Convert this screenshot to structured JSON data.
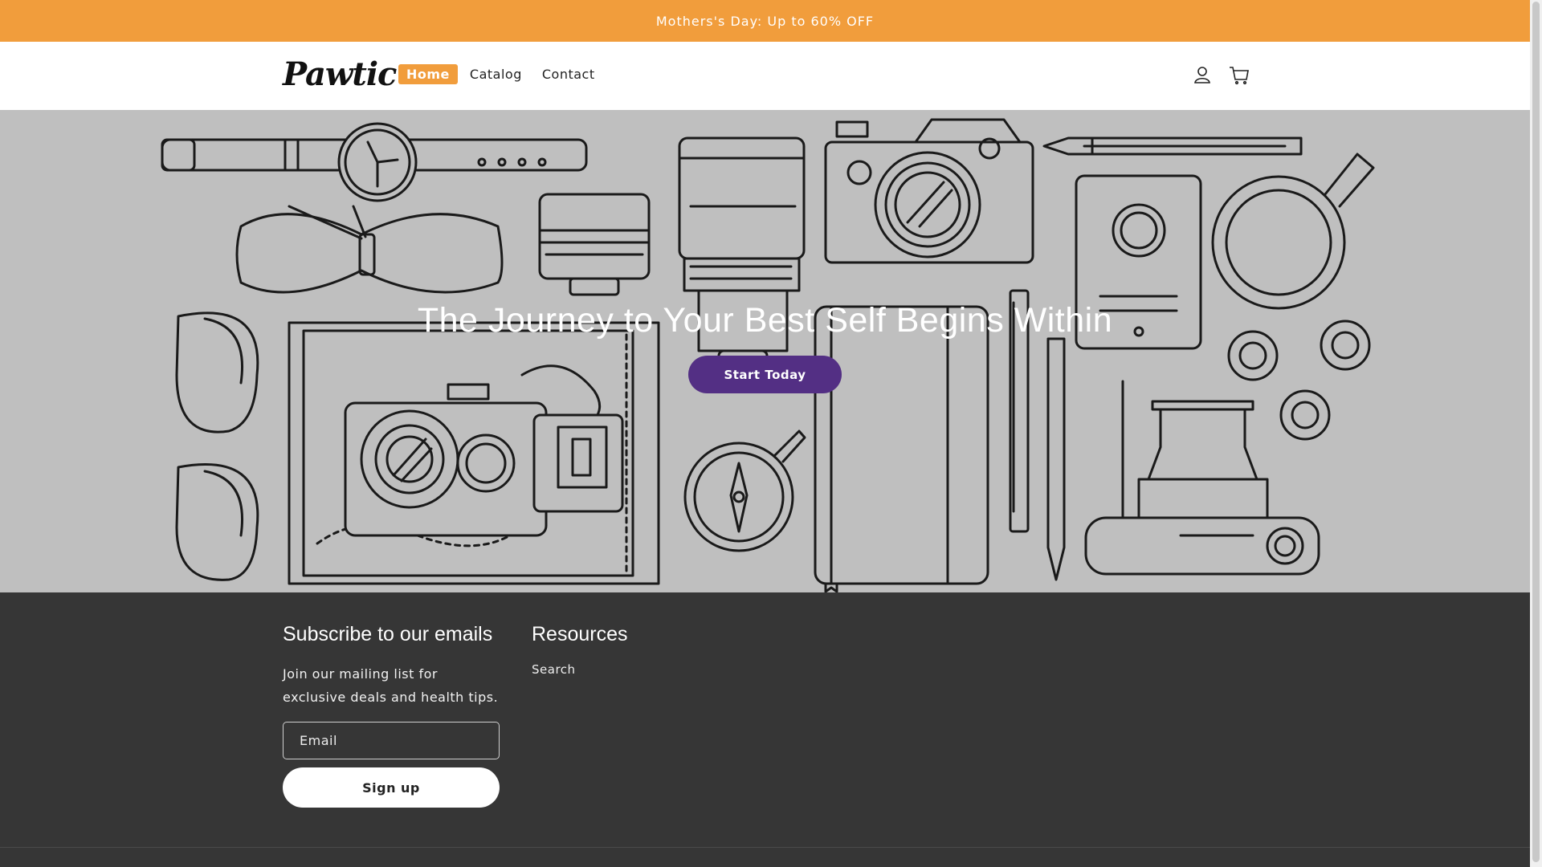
{
  "announcement": "Mothers's Day: Up to 60% OFF",
  "brand": {
    "logo_text": "Pawtic"
  },
  "nav": {
    "items": [
      {
        "label": "Home",
        "active": true
      },
      {
        "label": "Catalog",
        "active": false
      },
      {
        "label": "Contact",
        "active": false
      }
    ]
  },
  "header_icons": [
    "account-icon",
    "cart-icon"
  ],
  "hero": {
    "title": "The Journey to Your Best Self Begins Within",
    "button": "Start Today"
  },
  "footer": {
    "subscribe": {
      "heading": "Subscribe to our emails",
      "text": "Join our mailing list for exclusive deals and health tips.",
      "email_placeholder": "Email",
      "button": "Sign up"
    },
    "resources": {
      "heading": "Resources",
      "links": [
        "Search"
      ]
    }
  },
  "colors": {
    "accent": "#f19d3c",
    "hero_bg": "#bfbfbf",
    "button": "#532f84",
    "footer_bg": "#363636"
  }
}
